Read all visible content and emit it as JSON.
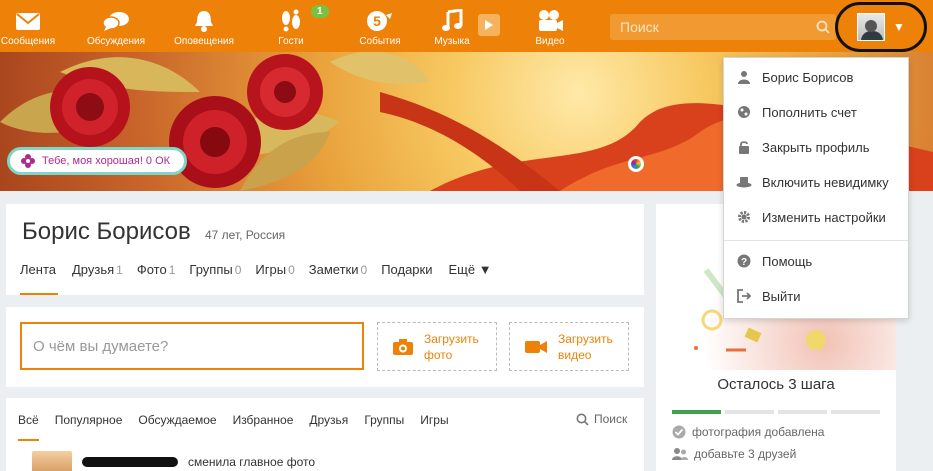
{
  "nav": {
    "items": [
      {
        "label": "Сообщения",
        "icon": "envelope-icon"
      },
      {
        "label": "Обсуждения",
        "icon": "chat-bubbles-icon"
      },
      {
        "label": "Оповещения",
        "icon": "bell-icon"
      },
      {
        "label": "Гости",
        "icon": "footprints-icon",
        "badge": "1"
      },
      {
        "label": "События",
        "icon": "events-5-icon",
        "badge_inner": "5"
      },
      {
        "label": "Музыка",
        "icon": "music-note-icon"
      },
      {
        "label": "Видео",
        "icon": "film-camera-icon"
      }
    ],
    "search_placeholder": "Поиск"
  },
  "banner": {
    "gift_text": "Тебе, моя хорошая! 0 ОК"
  },
  "profile": {
    "name": "Борис Борисов",
    "meta": "47 лет, Россия",
    "tabs": [
      {
        "label": "Лента",
        "count": ""
      },
      {
        "label": "Друзья",
        "count": "1"
      },
      {
        "label": "Фото",
        "count": "1"
      },
      {
        "label": "Группы",
        "count": "0"
      },
      {
        "label": "Игры",
        "count": "0"
      },
      {
        "label": "Заметки",
        "count": "0"
      },
      {
        "label": "Подарки",
        "count": ""
      },
      {
        "label": "Ещё ▼",
        "count": ""
      }
    ]
  },
  "post": {
    "placeholder": "О чём вы думаете?",
    "upload_photo": "Загрузить фото",
    "upload_video": "Загрузить видео"
  },
  "feed": {
    "filters": [
      "Всё",
      "Популярное",
      "Обсуждаемое",
      "Избранное",
      "Друзья",
      "Группы",
      "Игры"
    ],
    "search_label": "Поиск",
    "item_action": "сменила главное фото"
  },
  "steps": {
    "title": "Осталось 3 шага",
    "done_segments": 1,
    "total_segments": 4,
    "items": [
      "фотография добавлена",
      "добавьте 3 друзей"
    ]
  },
  "dropdown": {
    "items": [
      {
        "label": "Борис Борисов",
        "icon": "user-icon"
      },
      {
        "label": "Пополнить счет",
        "icon": "coins-icon"
      },
      {
        "label": "Закрыть профиль",
        "icon": "lock-icon"
      },
      {
        "label": "Включить невидимку",
        "icon": "hat-icon"
      },
      {
        "label": "Изменить настройки",
        "icon": "gear-icon"
      },
      {
        "label": "Помощь",
        "icon": "help-icon"
      },
      {
        "label": "Выйти",
        "icon": "logout-icon"
      }
    ]
  },
  "colors": {
    "brand": "#ee8208",
    "success": "#3fa14a",
    "gift_text": "#b0298d"
  }
}
